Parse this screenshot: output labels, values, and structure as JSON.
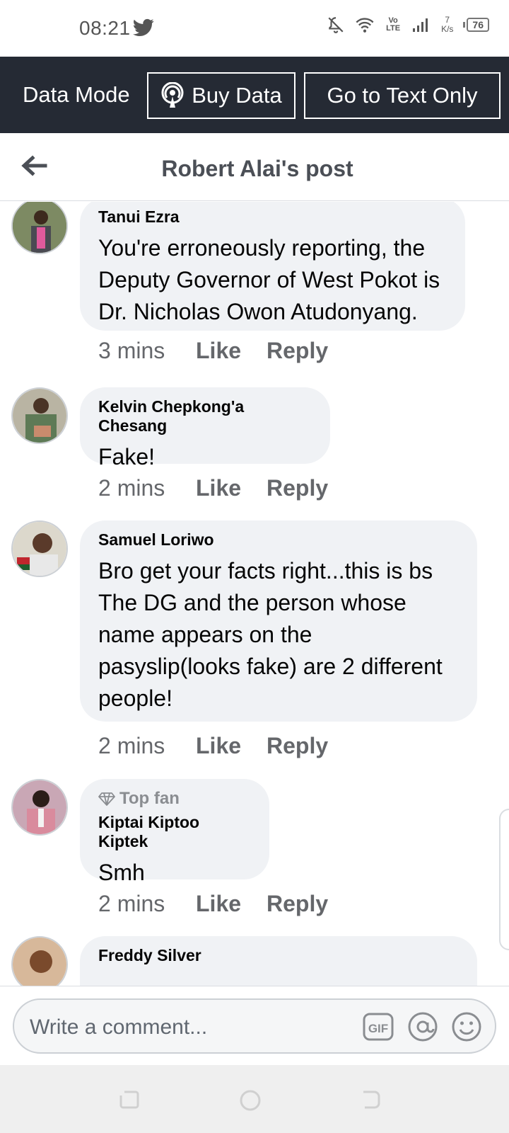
{
  "status_bar": {
    "time": "08:21",
    "lte": "Vo LTE",
    "net_speed_value": "7",
    "net_speed_unit": "K/s",
    "battery": "76"
  },
  "data_bar": {
    "mode_label": "Data Mode",
    "buy_data_label": "Buy Data",
    "text_only_label": "Go to Text Only"
  },
  "header": {
    "title": "Robert Alai's post"
  },
  "comments": [
    {
      "author": "Tanui Ezra",
      "text": "You're erroneously reporting, the Deputy Governor of West Pokot is Dr. Nicholas Owon Atudonyang.",
      "age": "3 mins",
      "like": "Like",
      "reply": "Reply"
    },
    {
      "author": "Kelvin Chepkong'a Chesang",
      "text": "Fake!",
      "age": "2 mins",
      "like": "Like",
      "reply": "Reply"
    },
    {
      "author": "Samuel Loriwo",
      "text": "Bro get your facts right...this is bs The DG and the person whose name appears on the pasyslip(looks fake) are 2 different people!",
      "age": "2 mins",
      "like": "Like",
      "reply": "Reply"
    },
    {
      "badge": "Top fan",
      "author": "Kiptai Kiptoo Kiptek",
      "text": "Smh",
      "age": "2 mins",
      "like": "Like",
      "reply": "Reply"
    },
    {
      "author": "Freddy Silver"
    }
  ],
  "composer": {
    "placeholder": "Write a comment...",
    "gif_label": "GIF"
  },
  "icons": {
    "status": [
      "twitter-icon",
      "mute-icon",
      "wifi-icon",
      "signal-icon",
      "battery-icon"
    ],
    "data_bar": [
      "broadcast-icon"
    ],
    "header": [
      "back-arrow-icon"
    ],
    "composer": [
      "gif-icon",
      "mention-icon",
      "emoji-icon"
    ],
    "navbar": [
      "recents-icon",
      "home-icon",
      "back-icon"
    ]
  },
  "colors": {
    "data_bar_bg": "#252a34",
    "bubble_bg": "#f0f2f5",
    "secondary_text": "#65676b"
  }
}
